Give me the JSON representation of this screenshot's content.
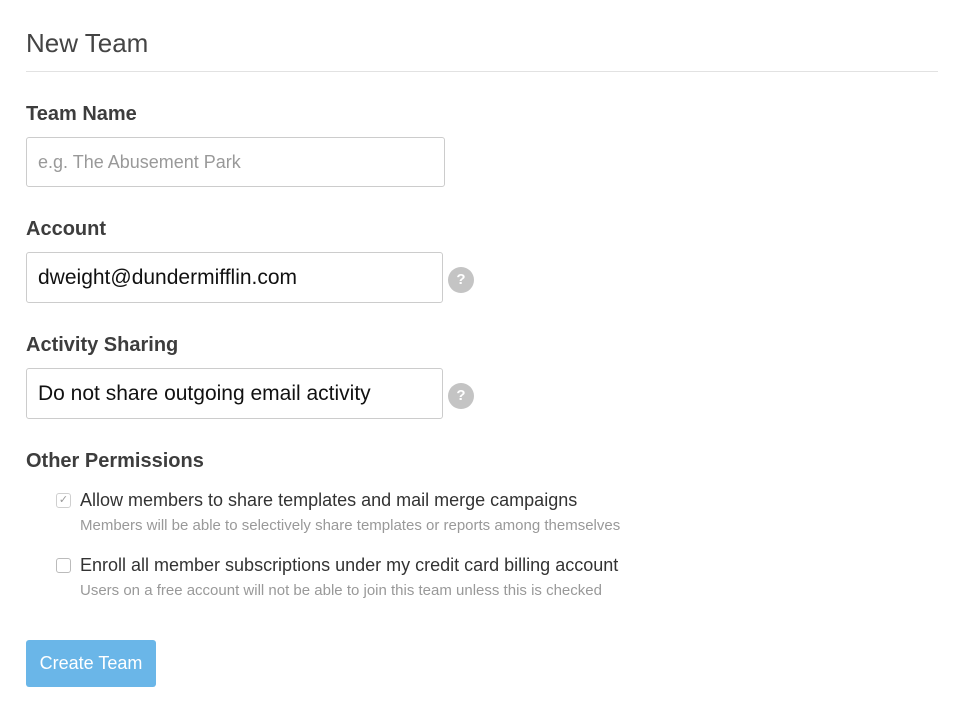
{
  "page": {
    "title": "New Team"
  },
  "team_name": {
    "label": "Team Name",
    "placeholder": "e.g. The Abusement Park",
    "value": ""
  },
  "account": {
    "label": "Account",
    "value": "dweight@dundermifflin.com",
    "help_icon": "?"
  },
  "activity_sharing": {
    "label": "Activity Sharing",
    "value": "Do not share outgoing email activity",
    "help_icon": "?"
  },
  "other_permissions": {
    "label": "Other Permissions",
    "items": [
      {
        "label": "Allow members to share templates and mail merge campaigns",
        "description": "Members will be able to selectively share templates or reports among themselves",
        "checked": true,
        "check_glyph": "✓"
      },
      {
        "label": "Enroll all member subscriptions under my credit card billing account",
        "description": "Users on a free account will not be able to join this team unless this is checked",
        "checked": false,
        "check_glyph": ""
      }
    ]
  },
  "actions": {
    "create_label": "Create Team"
  },
  "colors": {
    "button_bg": "#6ab6e8",
    "help_icon_bg": "#c4c4c4",
    "divider": "#e2e2e2"
  }
}
